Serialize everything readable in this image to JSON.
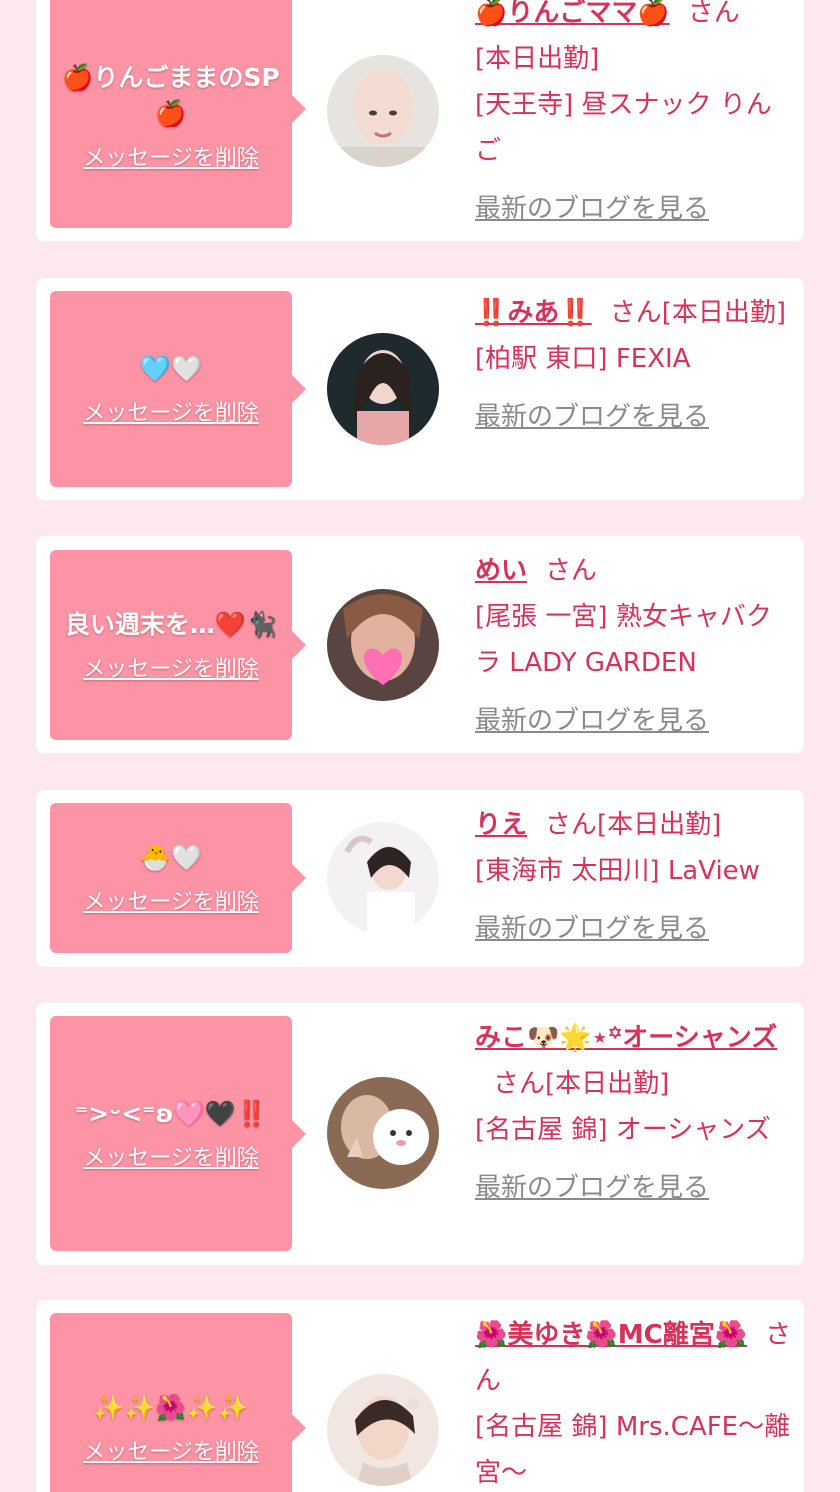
{
  "delete_label": "メッセージを削除",
  "blog_label": "最新のブログを見る",
  "san_label": "さん",
  "cards": [
    {
      "message": "🍎りんごままのSP🍎",
      "name": "🍎りんごママ🍎",
      "after_san": "",
      "status": "[本日出勤]",
      "shop": "[天王寺] 昼スナック りんご",
      "avatar_icon": "avatar-photo"
    },
    {
      "message": "🩵🤍",
      "name": "‼️みあ‼️",
      "after_san": "[本日出勤]",
      "status": "",
      "shop": "[柏駅 東口] FEXIA",
      "avatar_icon": "avatar-photo"
    },
    {
      "message": "良い週末を…❤️🐈‍⬛",
      "name": "めい",
      "after_san": "",
      "status": "",
      "shop": "[尾張 一宮] 熟女キャバクラ LADY GARDEN",
      "avatar_icon": "avatar-photo"
    },
    {
      "message": "🐣🤍",
      "name": "りえ",
      "after_san": "[本日出勤]",
      "status": "",
      "shop": "[東海市 太田川] LaView",
      "avatar_icon": "avatar-photo"
    },
    {
      "message": "⁼>ᵕ<⁼ʚ🩷🖤‼️",
      "name": "みこ🐶🌟⋆꙳オーシャンズ",
      "after_san": "[本日出勤]",
      "status": "",
      "shop": "[名古屋 錦] オーシャンズ",
      "avatar_icon": "avatar-photo"
    },
    {
      "message": "✨✨🌺✨✨",
      "name": "🌺美ゆき🌺MC離宮🌺",
      "after_san": "",
      "status": "",
      "shop": "[名古屋 錦] Mrs.CAFE〜離宮〜",
      "avatar_icon": "avatar-photo"
    }
  ],
  "colors": {
    "page_bg": "#fce8ee",
    "bubble": "#fd94a5",
    "accent": "#d6325a",
    "link_gray": "#8a8a8a"
  }
}
